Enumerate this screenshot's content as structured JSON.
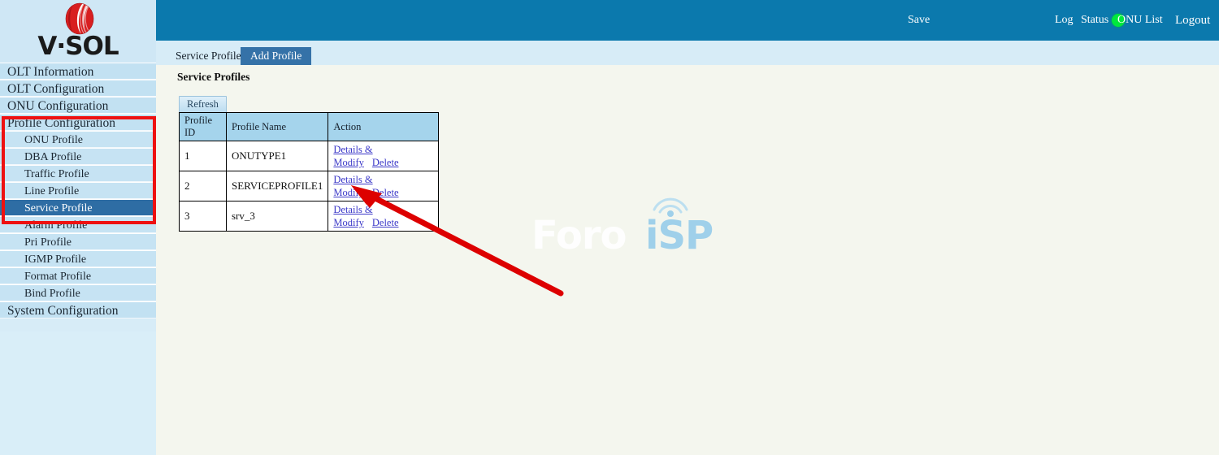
{
  "brand": {
    "logo_text": "V·SOL",
    "logo_icon": "vsol-sphere-logo"
  },
  "topbar": {
    "save_label": "Save",
    "status_indicator": "green-status-dot",
    "status_color": "#00e83c",
    "bar_color": "#0b79ad",
    "links": [
      {
        "label": "Log"
      },
      {
        "label": "Status"
      },
      {
        "label": "ONU List"
      },
      {
        "label": "Logout"
      }
    ]
  },
  "sidebar": {
    "background": "#d7ecf7",
    "highlight_color": "#ee1111",
    "selected_color": "#2e6da4",
    "items": [
      {
        "label": "OLT Information",
        "level": "top",
        "selected": false
      },
      {
        "label": "OLT Configuration",
        "level": "top",
        "selected": false
      },
      {
        "label": "ONU Configuration",
        "level": "top",
        "selected": false
      },
      {
        "label": "Profile Configuration",
        "level": "top",
        "selected": false
      },
      {
        "label": "ONU Profile",
        "level": "sub",
        "selected": false
      },
      {
        "label": "DBA Profile",
        "level": "sub",
        "selected": false
      },
      {
        "label": "Traffic Profile",
        "level": "sub",
        "selected": false
      },
      {
        "label": "Line Profile",
        "level": "sub",
        "selected": false
      },
      {
        "label": "Service Profile",
        "level": "sub",
        "selected": true
      },
      {
        "label": "Alarm Profile",
        "level": "sub",
        "selected": false
      },
      {
        "label": "Pri Profile",
        "level": "sub",
        "selected": false
      },
      {
        "label": "IGMP Profile",
        "level": "sub",
        "selected": false
      },
      {
        "label": "Format Profile",
        "level": "sub",
        "selected": false
      },
      {
        "label": "Bind Profile",
        "level": "sub",
        "selected": false
      },
      {
        "label": "System Configuration",
        "level": "top",
        "selected": false
      }
    ]
  },
  "tabs": [
    {
      "label": "Service Profiles",
      "active": false
    },
    {
      "label": "Add Profile",
      "active": true
    }
  ],
  "main": {
    "page_title": "Service Profiles",
    "refresh_label": "Refresh",
    "table": {
      "headers": [
        "Profile ID",
        "Profile Name",
        "Action"
      ],
      "rows": [
        {
          "id": "1",
          "name": "ONUTYPE1",
          "details_label": "Details & Modify",
          "delete_label": "Delete"
        },
        {
          "id": "2",
          "name": "SERVICEPROFILE1",
          "details_label": "Details & Modify",
          "delete_label": "Delete"
        },
        {
          "id": "3",
          "name": "srv_3",
          "details_label": "Details & Modify",
          "delete_label": "Delete"
        }
      ]
    }
  },
  "watermark": {
    "text_light": "Foro",
    "text_accent": "iSP",
    "icon": "wifi-tower-icon",
    "accent_color": "#9fd0ea"
  },
  "annotation": {
    "arrow_color": "#dd0000",
    "arrow_points_to": "Details & Modify link on row 3"
  }
}
